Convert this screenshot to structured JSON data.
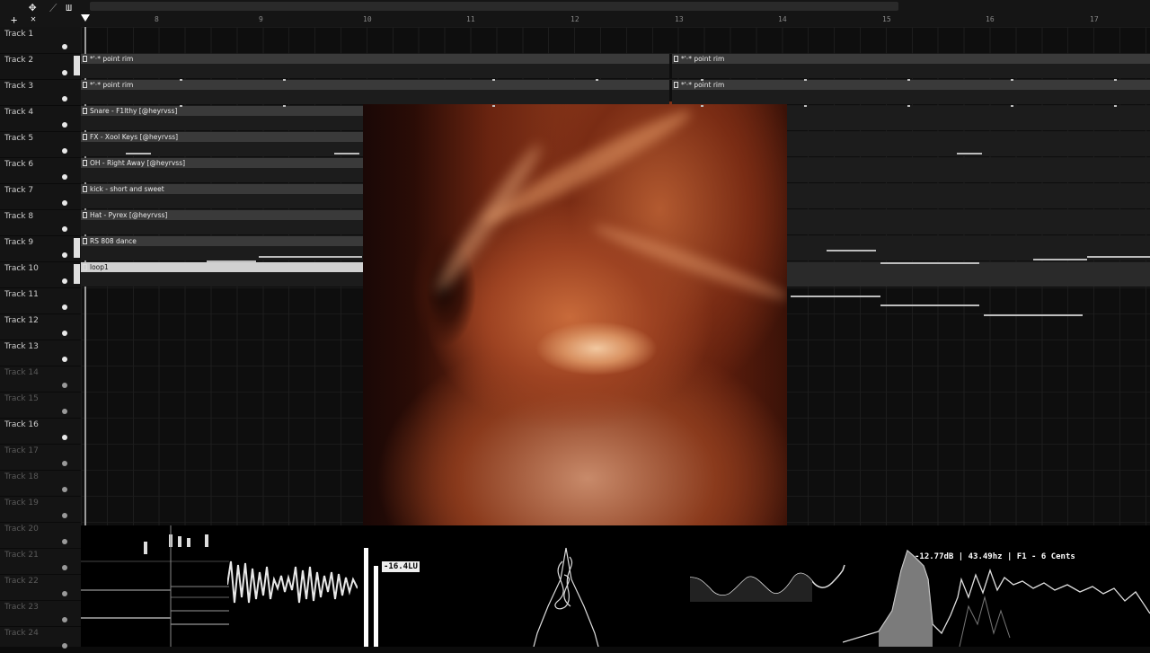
{
  "toolbar": {
    "buttons": [
      {
        "name": "move-tool-icon",
        "glyph": "✥"
      },
      {
        "name": "draw-tool-icon",
        "glyph": "⟋"
      },
      {
        "name": "grid-tool-icon",
        "glyph": "ш"
      },
      {
        "name": "add-icon",
        "glyph": "+"
      },
      {
        "name": "close-icon",
        "glyph": "✕"
      }
    ]
  },
  "timeline": {
    "bars": [
      "8",
      "9",
      "10",
      "11",
      "12",
      "13",
      "14",
      "15",
      "16",
      "17"
    ]
  },
  "tracks": [
    {
      "label": "Track 1",
      "active": true
    },
    {
      "label": "Track 2",
      "active": true
    },
    {
      "label": "Track 3",
      "active": true
    },
    {
      "label": "Track 4",
      "active": true
    },
    {
      "label": "Track 5",
      "active": true
    },
    {
      "label": "Track 6",
      "active": true
    },
    {
      "label": "Track 7",
      "active": true
    },
    {
      "label": "Track 8",
      "active": true
    },
    {
      "label": "Track 9",
      "active": true
    },
    {
      "label": "Track 10",
      "active": true
    },
    {
      "label": "Track 11",
      "active": true
    },
    {
      "label": "Track 12",
      "active": true
    },
    {
      "label": "Track 13",
      "active": true
    },
    {
      "label": "Track 14",
      "active": false
    },
    {
      "label": "Track 15",
      "active": false
    },
    {
      "label": "Track 16",
      "active": true
    },
    {
      "label": "Track 17",
      "active": false
    },
    {
      "label": "Track 18",
      "active": false
    },
    {
      "label": "Track 19",
      "active": false
    },
    {
      "label": "Track 20",
      "active": false
    },
    {
      "label": "Track 21",
      "active": false
    },
    {
      "label": "Track 22",
      "active": false
    },
    {
      "label": "Track 23",
      "active": false
    },
    {
      "label": "Track 24",
      "active": false
    }
  ],
  "clips": [
    {
      "track": 2,
      "label": "*'·* point rim"
    },
    {
      "track": 2,
      "label": "*'·* point rim"
    },
    {
      "track": 3,
      "label": "*'·* point rim"
    },
    {
      "track": 3,
      "label": "*'·* point rim"
    },
    {
      "track": 4,
      "label": "Snare - F1lthy [@heyrvss]"
    },
    {
      "track": 5,
      "label": "FX - Xool Keys [@heyrvss]"
    },
    {
      "track": 6,
      "label": "OH - Right Away [@heyrvss]"
    },
    {
      "track": 7,
      "label": "kick - short and sweet"
    },
    {
      "track": 8,
      "label": "Hat - Pyrex [@heyrvss]"
    },
    {
      "track": 9,
      "label": "RS 808 dance"
    },
    {
      "track": 10,
      "label": "loop1"
    }
  ],
  "meters": {
    "loudness": "-16.4LU",
    "spectrum_readout": "-12.77dB | 43.49hz | F1 - 6 Cents"
  }
}
